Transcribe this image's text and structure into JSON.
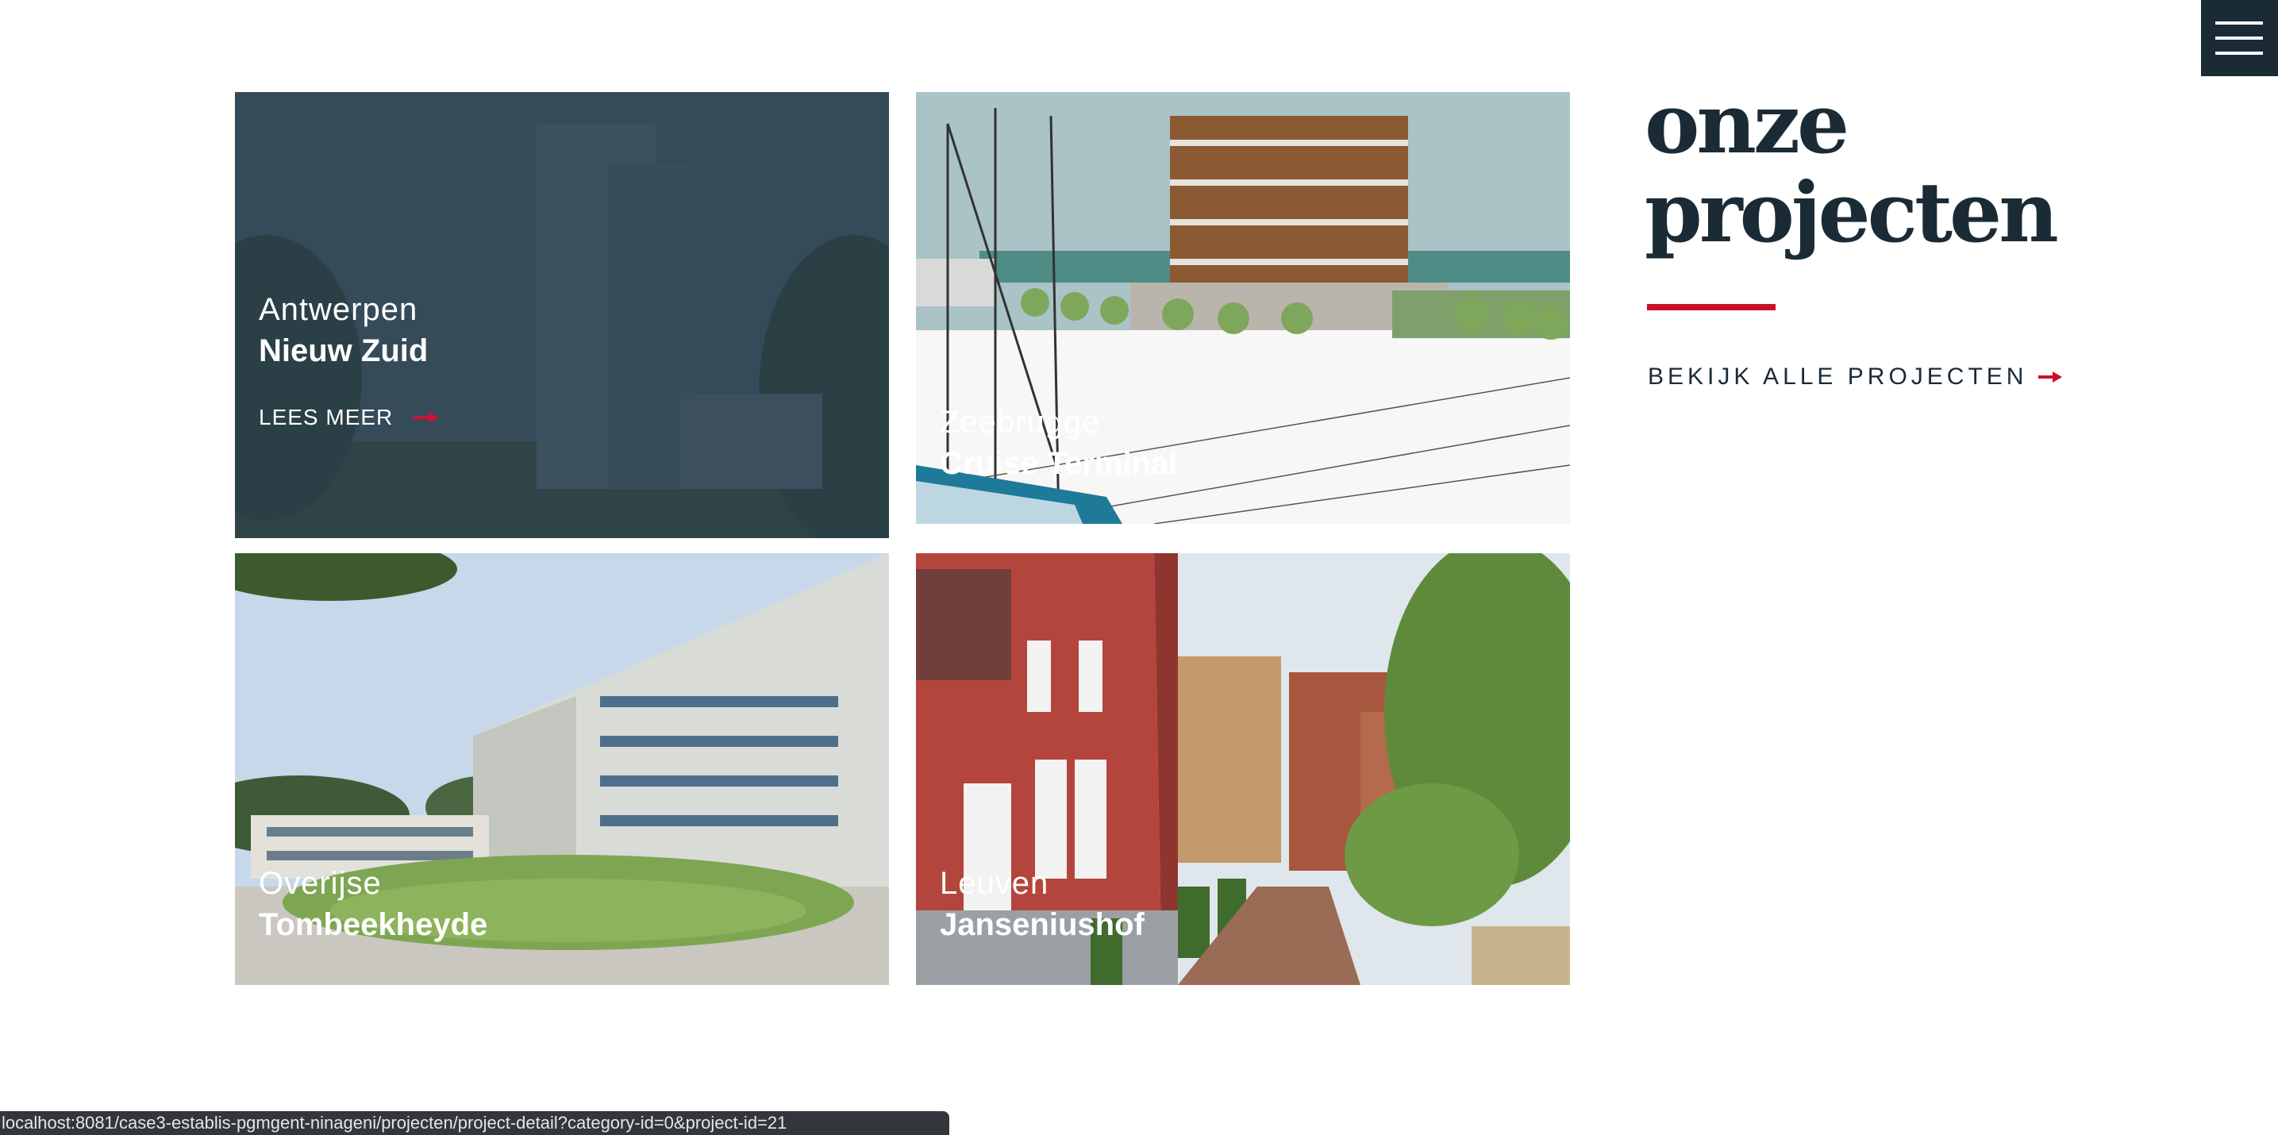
{
  "menu": {
    "icon": "hamburger-menu-icon"
  },
  "projects": [
    {
      "city": "Antwerpen",
      "name": "Nieuw Zuid",
      "link_label": "LEES MEER"
    },
    {
      "city": "Zeebrugge",
      "name": "Cruise Terminal"
    },
    {
      "city": "Overijse",
      "name": "Tombeekheyde"
    },
    {
      "city": "Leuven",
      "name": "Janseniushof"
    }
  ],
  "section": {
    "heading_line1": "onze",
    "heading_line2": "projecten",
    "all_projects_label": "BEKIJK ALLE PROJECTEN"
  },
  "status_bar": {
    "url": "localhost:8081/case3-establis-pgmgent-ninageni/projecten/project-detail?category-id=0&project-id=21"
  },
  "colors": {
    "navy": "#1b2b36",
    "accent_red": "#c8102e",
    "white": "#ffffff"
  }
}
